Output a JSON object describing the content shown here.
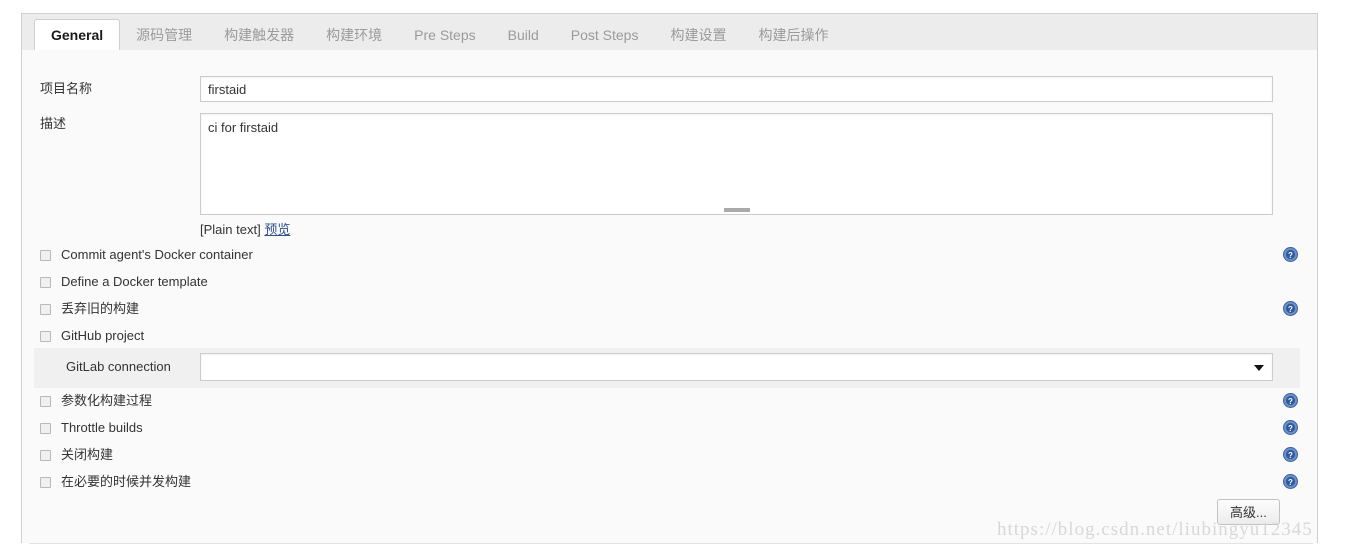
{
  "tabs": [
    {
      "label": "General",
      "active": true
    },
    {
      "label": "源码管理",
      "active": false
    },
    {
      "label": "构建触发器",
      "active": false
    },
    {
      "label": "构建环境",
      "active": false
    },
    {
      "label": "Pre Steps",
      "active": false
    },
    {
      "label": "Build",
      "active": false
    },
    {
      "label": "Post Steps",
      "active": false
    },
    {
      "label": "构建设置",
      "active": false
    },
    {
      "label": "构建后操作",
      "active": false
    }
  ],
  "form": {
    "project_name": {
      "label": "项目名称",
      "value": "firstaid",
      "placeholder": ""
    },
    "description": {
      "label": "描述",
      "value": "ci for firstaid",
      "placeholder": "",
      "markup_note": "[Plain text]",
      "preview_link": "预览"
    }
  },
  "checkboxes": [
    {
      "label": "Commit agent's Docker container",
      "checked": false,
      "help": true
    },
    {
      "label": "Define a Docker template",
      "checked": false,
      "help": false
    },
    {
      "label": "丢弃旧的构建",
      "checked": false,
      "help": true
    },
    {
      "label": "GitHub project",
      "checked": false,
      "help": false
    },
    {
      "label": "参数化构建过程",
      "checked": false,
      "help": true
    },
    {
      "label": "Throttle builds",
      "checked": false,
      "help": true
    },
    {
      "label": "关闭构建",
      "checked": false,
      "help": true
    },
    {
      "label": "在必要的时候并发构建",
      "checked": false,
      "help": true
    }
  ],
  "gitlab_connection": {
    "label": "GitLab connection",
    "value": "",
    "options": [
      ""
    ]
  },
  "advanced_button": {
    "label": "高级..."
  },
  "watermark": {
    "text": "https://blog.csdn.net/liubingyu12345"
  },
  "icons": {
    "help": "help-icon",
    "caret": "chevron-down-icon",
    "resize": "resize-grip-icon"
  },
  "colors": {
    "tabbar_bg": "#ececec",
    "content_bg": "#fafafa",
    "panel_bg": "#f0f0f0",
    "border": "#cfcfcf",
    "help_blue": "#4a72b8",
    "link": "#2f4f8f",
    "text": "#333333",
    "tab_inactive_text": "#9b9b9b"
  }
}
